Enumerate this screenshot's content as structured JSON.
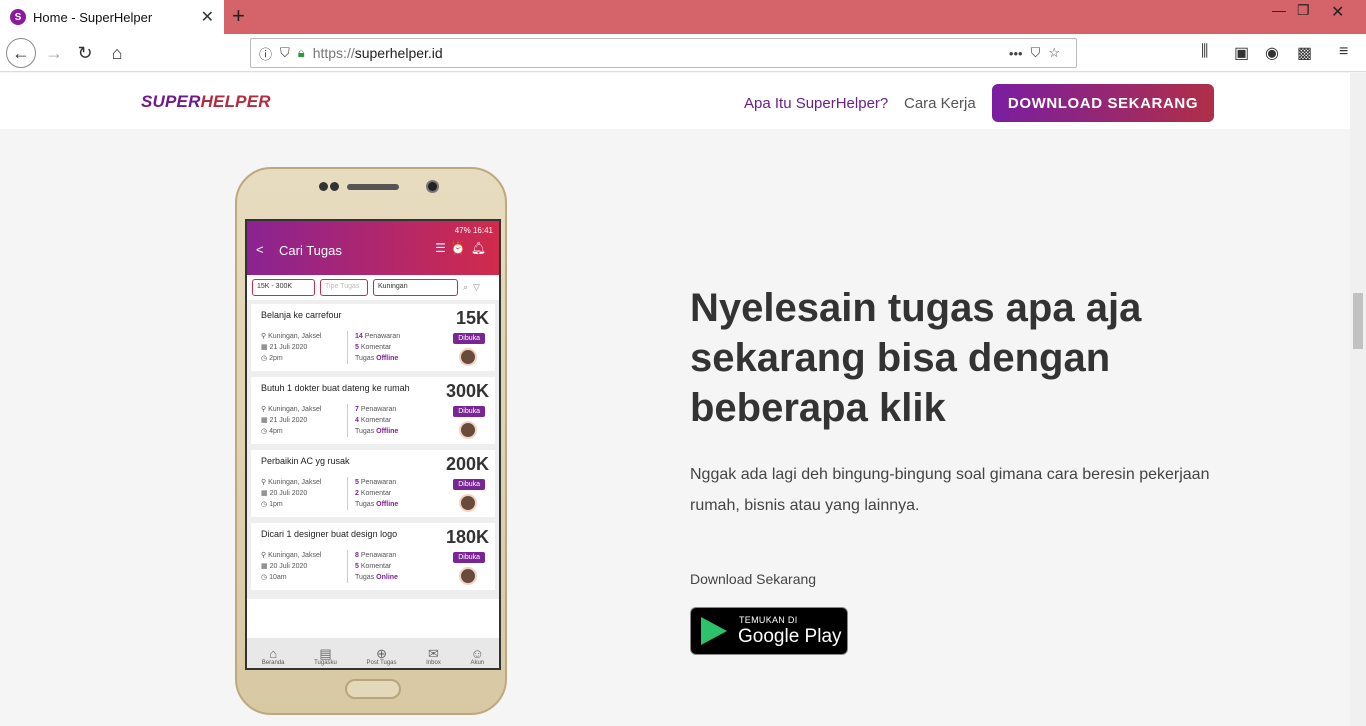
{
  "browser": {
    "tab_title": "Home - SuperHelper",
    "url_protocol": "https://",
    "url_host": "superhelper.id"
  },
  "site": {
    "logo_part1": "SUPER",
    "logo_part2": "HELPER",
    "nav_what": "Apa Itu SuperHelper?",
    "nav_how": "Cara Kerja",
    "download_button": "DOWNLOAD SEKARANG"
  },
  "app": {
    "status": "47%  16:41",
    "title": "Cari Tugas",
    "filter_price": "15K - 300K",
    "filter_type_placeholder": "Tipe Tugas",
    "filter_location": "Kuningan",
    "tasks": [
      {
        "title": "Belanja ke carrefour",
        "price": "15K",
        "badge": "Dibuka",
        "location": "Kuningan, Jaksel",
        "date": "21 Juli 2020",
        "time": "2pm",
        "offers_n": "14",
        "offers": "Penawaran",
        "comments_n": "5",
        "comments": "Komentar",
        "type_label": "Tugas",
        "type": "Offline"
      },
      {
        "title": "Butuh 1 dokter buat dateng ke rumah",
        "price": "300K",
        "badge": "Dibuka",
        "location": "Kuningan, Jaksel",
        "date": "21 Juli 2020",
        "time": "4pm",
        "offers_n": "7",
        "offers": "Penawaran",
        "comments_n": "4",
        "comments": "Komentar",
        "type_label": "Tugas",
        "type": "Offline"
      },
      {
        "title": "Perbaikin AC yg rusak",
        "price": "200K",
        "badge": "Dibuka",
        "location": "Kuningan, Jaksel",
        "date": "20 Juli 2020",
        "time": "1pm",
        "offers_n": "5",
        "offers": "Penawaran",
        "comments_n": "2",
        "comments": "Komentar",
        "type_label": "Tugas",
        "type": "Offline"
      },
      {
        "title": "Dicari 1 designer buat design logo",
        "price": "180K",
        "badge": "Dibuka",
        "location": "Kuningan, Jaksel",
        "date": "20 Juli 2020",
        "time": "10am",
        "offers_n": "8",
        "offers": "Penawaran",
        "comments_n": "5",
        "comments": "Komentar",
        "type_label": "Tugas",
        "type": "Online"
      }
    ],
    "bottom_nav": [
      "Beranda",
      "Tugasku",
      "Post Tugas",
      "Inbox",
      "Akun"
    ]
  },
  "hero": {
    "headline": "Nyelesain tugas apa aja sekarang bisa dengan beberapa klik",
    "subtitle": "Nggak ada lagi deh bingung-bingung soal gimana cara beresin pekerjaan rumah, bisnis atau yang lainnya.",
    "download_label": "Download Sekarang",
    "play_line1": "TEMUKAN DI",
    "play_line2": "Google Play"
  }
}
